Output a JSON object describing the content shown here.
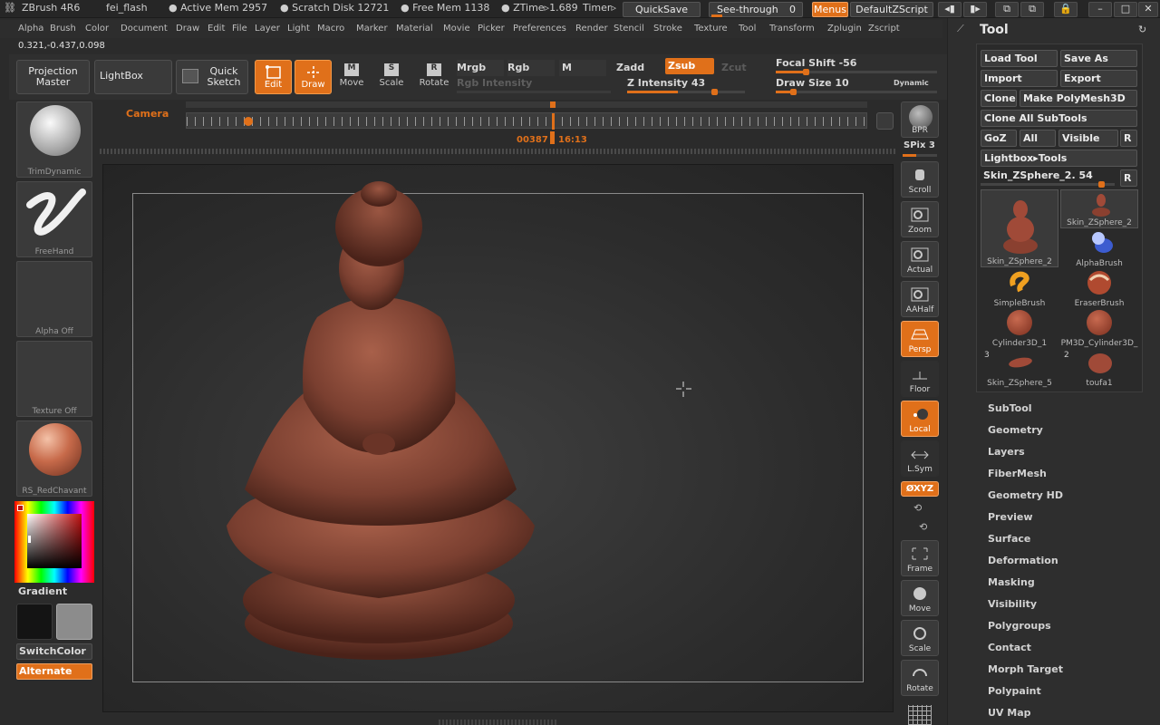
{
  "title_bar": {
    "app": "ZBrush 4R6",
    "doc": "fei_flash",
    "active_mem": "● Active Mem 2957",
    "scratch": "● Scratch Disk 12721",
    "free_mem": "● Free Mem 1138",
    "ztime": "● ZTime▹1.689",
    "timer": "Timer▹",
    "quicksave": "QuickSave",
    "see_through": "See-through",
    "see_through_val": "0",
    "menus": "Menus",
    "script": "DefaultZScript"
  },
  "menu": [
    "Alpha",
    "Brush",
    "Color",
    "Document",
    "Draw",
    "Edit",
    "File",
    "Layer",
    "Light",
    "Macro",
    "Marker",
    "Material",
    "Movie",
    "Picker",
    "Preferences",
    "Render",
    "Stencil",
    "Stroke",
    "Texture",
    "Tool",
    "Transform",
    "Zplugin",
    "Zscript"
  ],
  "coords": "0.321,-0.437,0.098",
  "toolbar": {
    "projection_master": "Projection Master",
    "lightbox": "LightBox",
    "quick_sketch": "Quick Sketch",
    "edit": "Edit",
    "draw": "Draw",
    "move": "Move",
    "scale": "Scale",
    "rotate": "Rotate",
    "mrgb": "Mrgb",
    "rgb": "Rgb",
    "m": "M",
    "zadd": "Zadd",
    "zsub": "Zsub",
    "zcut": "Zcut",
    "rgb_intensity": "Rgb Intensity",
    "z_intensity": "Z Intensity 43",
    "focal_shift": "Focal Shift -56",
    "draw_size": "Draw Size 10",
    "dynamic": "Dynamic"
  },
  "timeline": {
    "label": "Camera",
    "time": "00387",
    "time2": "16:13"
  },
  "left_shelf": {
    "brush_top": "TrimDynamic",
    "stroke": "FreeHand",
    "alpha": "Alpha Off",
    "texture": "Texture Off",
    "material": "RS_RedChavant",
    "gradient": "Gradient",
    "switch_color": "SwitchColor",
    "alternate": "Alternate"
  },
  "right_shelf": {
    "bpr": "BPR",
    "spix": "SPix 3",
    "scroll": "Scroll",
    "zoom": "Zoom",
    "actual": "Actual",
    "aahalf": "AAHalf",
    "persp": "Persp",
    "floor": "Floor",
    "local": "Local",
    "lsym": "L.Sym",
    "xyz": "ØXYZ",
    "frame": "Frame",
    "move": "Move",
    "scale": "Scale",
    "rotate": "Rotate"
  },
  "tool_panel": {
    "title": "Tool",
    "load_tool": "Load Tool",
    "save_as": "Save As",
    "import": "Import",
    "export": "Export",
    "clone": "Clone",
    "make_polymesh": "Make PolyMesh3D",
    "clone_all": "Clone All SubTools",
    "goz": "GoZ",
    "all": "All",
    "visible": "Visible",
    "r": "R",
    "lightbox_tools": "Lightbox▸Tools",
    "current_tool": "Skin_ZSphere_2. 54",
    "r2": "R",
    "tools": [
      {
        "name": "Skin_ZSphere_2",
        "badge": ""
      },
      {
        "name": "Skin_ZSphere_2",
        "badge": ""
      },
      {
        "name": "AlphaBrush",
        "badge": ""
      },
      {
        "name": "SimpleBrush",
        "badge": ""
      },
      {
        "name": "EraserBrush",
        "badge": ""
      },
      {
        "name": "Cylinder3D_1",
        "badge": ""
      },
      {
        "name": "PM3D_Cylinder3D_",
        "badge": ""
      },
      {
        "name": "Skin_ZSphere_5",
        "badge": "3"
      },
      {
        "name": "toufa1",
        "badge": "2"
      }
    ],
    "sections": [
      "SubTool",
      "Geometry",
      "Layers",
      "FiberMesh",
      "Geometry HD",
      "Preview",
      "Surface",
      "Deformation",
      "Masking",
      "Visibility",
      "Polygroups",
      "Contact",
      "Morph Target",
      "Polypaint",
      "UV Map"
    ]
  },
  "colors": {
    "accent": "#e0701a",
    "clay": "#8a4a38"
  }
}
